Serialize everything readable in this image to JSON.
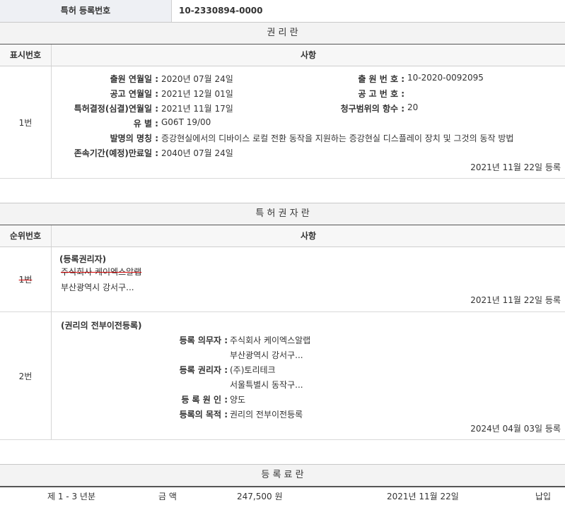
{
  "top": {
    "label": "특허 등록번호",
    "value": "10-2330894-0000"
  },
  "rights": {
    "title": "권 리 란",
    "col_num": "표시번호",
    "col_item": "사항",
    "row_num": "1번",
    "left_fields": [
      {
        "label": "출원 연월일 :",
        "value": "2020년 07월 24일"
      },
      {
        "label": "공고 연월일 :",
        "value": "2021년 12월 01일"
      },
      {
        "label": "특허결정(심결)연월일 :",
        "value": "2021년 11월 17일"
      },
      {
        "label": "유 별 :",
        "value": "G06T 19/00"
      },
      {
        "label": "발명의 명칭 :",
        "value": "증강현실에서의 디바이스 로컬 전환 동작을 지원하는 증강현실 디스플레이 장치 및 그것의 동작 방법"
      },
      {
        "label": "존속기간(예정)만료일 :",
        "value": "2040년 07월 24일"
      }
    ],
    "right_fields": [
      {
        "label": "출 원 번 호 :",
        "value": "10-2020-0092095"
      },
      {
        "label": "공 고 번 호 :",
        "value": ""
      },
      {
        "label": "청구범위의 항수 :",
        "value": "20"
      }
    ],
    "registered": "2021년 11월 22일 등록"
  },
  "owners": {
    "title": "특 허 권 자 란",
    "col_num": "순위번호",
    "col_item": "사항",
    "row1": {
      "num": "1번",
      "heading": "(등록권리자)",
      "name": "주식회사 케이엑스알랩",
      "address": "부산광역시 강서구...",
      "registered": "2021년 11월 22일 등록"
    },
    "row2": {
      "num": "2번",
      "heading": "(권리의 전부이전등록)",
      "obligor_label": "등록 의무자 :",
      "obligor_name": "주식회사 케이엑스알랩",
      "obligor_address": "부산광역시 강서구...",
      "holder_label": "등록 권리자 :",
      "holder_name": "(주)토리테크",
      "holder_address": "서울특별시 동작구...",
      "cause_label": "등 록 원 인 :",
      "cause_value": "양도",
      "purpose_label": "등록의 목적 :",
      "purpose_value": "권리의 전부이전등록",
      "registered": "2024년 04월 03일 등록"
    }
  },
  "fees": {
    "title": "등 록 료 란",
    "period": "제 1 - 3 년분",
    "amount_label": "금 액",
    "amount": "247,500 원",
    "date": "2021년 11월 22일",
    "status": "납입"
  }
}
